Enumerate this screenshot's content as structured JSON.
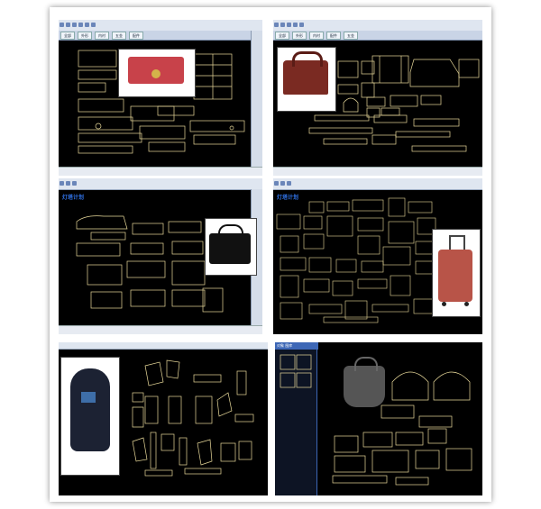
{
  "colors": {
    "canvas": "#000000",
    "outline": "#e8d99a",
    "accent": "#c9a227",
    "toolbar": "#dfe6f0",
    "tab": "#c9d4e6"
  },
  "panels": [
    {
      "id": "p1",
      "tabs": [
        "全部",
        "外形",
        "内衬",
        "五金",
        "配件"
      ]
    },
    {
      "id": "p2",
      "tabs": [
        "全部",
        "外形",
        "内衬",
        "配件",
        "五金"
      ]
    },
    {
      "id": "p3",
      "logo": "灯塔计划"
    },
    {
      "id": "p4",
      "logo": "灯塔计划"
    },
    {
      "id": "p5"
    },
    {
      "id": "p6",
      "header": "对象 图库"
    }
  ],
  "products": {
    "p1": "red wallet",
    "p2": "brown handbag",
    "p3": "black briefcase",
    "p4": "trolley suitcase",
    "p5": "black backpack",
    "p6": "grey tote bag"
  }
}
